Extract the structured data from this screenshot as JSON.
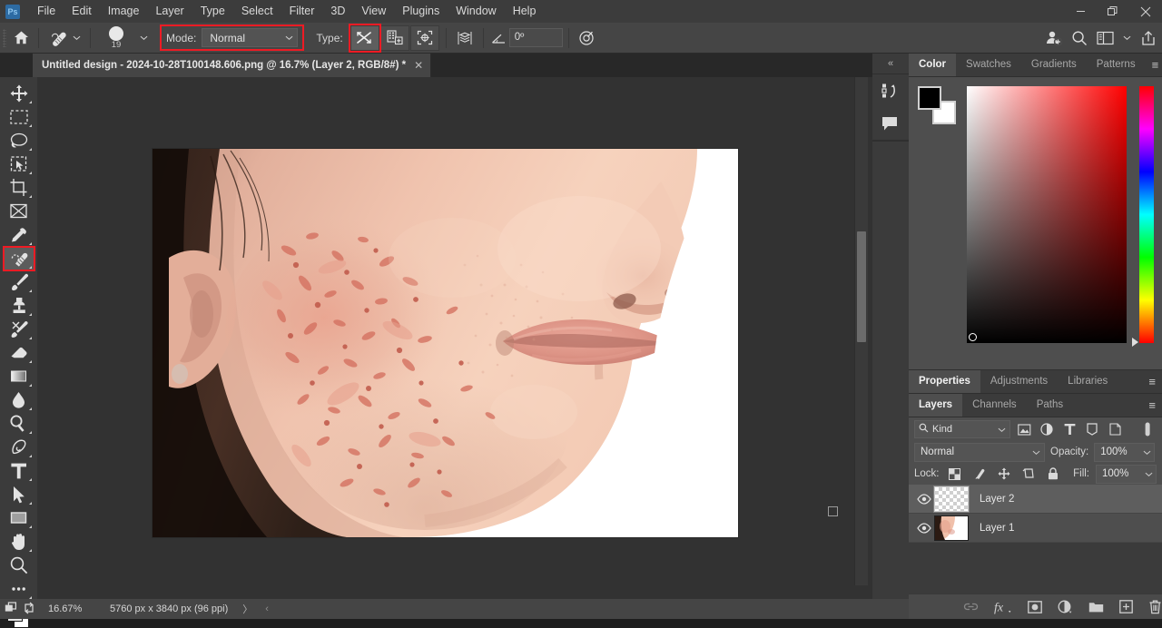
{
  "app": {
    "name": "Adobe Photoshop",
    "logo_text": "Ps"
  },
  "menubar": {
    "items": [
      {
        "label": "File"
      },
      {
        "label": "Edit"
      },
      {
        "label": "Image"
      },
      {
        "label": "Layer"
      },
      {
        "label": "Type"
      },
      {
        "label": "Select"
      },
      {
        "label": "Filter"
      },
      {
        "label": "3D"
      },
      {
        "label": "View"
      },
      {
        "label": "Plugins"
      },
      {
        "label": "Window"
      },
      {
        "label": "Help"
      }
    ],
    "window_controls": {
      "minimize": "—",
      "maximize": "❐",
      "close": "✕"
    }
  },
  "options_bar": {
    "home_icon": "home-icon",
    "tool_icon": "spot-healing-brush-icon",
    "brush_size": "19",
    "mode_label": "Mode:",
    "mode_value": "Normal",
    "mode_highlighted": true,
    "type_label": "Type:",
    "type_buttons": [
      {
        "name": "content-aware",
        "selected": true,
        "highlighted": true
      },
      {
        "name": "create-texture",
        "selected": false,
        "highlighted": false
      },
      {
        "name": "proximity-match",
        "selected": false,
        "highlighted": false
      }
    ],
    "sample_all_layers_icon": "stacked-layers-icon",
    "angle_label_icon": "angle-icon",
    "angle_value": "0º",
    "pressure_icon": "pressure-for-size-icon",
    "right_icons": [
      "share-person-icon",
      "search-icon",
      "workspace-icon",
      "chevron-down-icon",
      "export-icon"
    ]
  },
  "document": {
    "tab_title": "Untitled design - 2024-10-28T100148.606.png @ 16.7% (Layer 2, RGB/8#) *",
    "close_glyph": "✕"
  },
  "tools": [
    {
      "name": "move-tool",
      "icon": "move-icon",
      "has_flyout": true,
      "active": false,
      "highlighted": false
    },
    {
      "name": "rectangular-marquee-tool",
      "icon": "marquee-icon",
      "has_flyout": true,
      "active": false,
      "highlighted": false
    },
    {
      "name": "lasso-tool",
      "icon": "lasso-icon",
      "has_flyout": true,
      "active": false,
      "highlighted": false
    },
    {
      "name": "object-selection-tool",
      "icon": "object-selection-icon",
      "has_flyout": true,
      "active": false,
      "highlighted": false
    },
    {
      "name": "crop-tool",
      "icon": "crop-icon",
      "has_flyout": true,
      "active": false,
      "highlighted": false
    },
    {
      "name": "frame-tool",
      "icon": "frame-icon",
      "has_flyout": false,
      "active": false,
      "highlighted": false
    },
    {
      "name": "eyedropper-tool",
      "icon": "eyedropper-icon",
      "has_flyout": true,
      "active": false,
      "highlighted": false
    },
    {
      "name": "spot-healing-brush-tool",
      "icon": "spot-healing-brush-icon",
      "has_flyout": true,
      "active": true,
      "highlighted": true
    },
    {
      "name": "brush-tool",
      "icon": "brush-icon",
      "has_flyout": true,
      "active": false,
      "highlighted": false
    },
    {
      "name": "clone-stamp-tool",
      "icon": "clone-stamp-icon",
      "has_flyout": true,
      "active": false,
      "highlighted": false
    },
    {
      "name": "history-brush-tool",
      "icon": "history-brush-icon",
      "has_flyout": true,
      "active": false,
      "highlighted": false
    },
    {
      "name": "eraser-tool",
      "icon": "eraser-icon",
      "has_flyout": true,
      "active": false,
      "highlighted": false
    },
    {
      "name": "gradient-tool",
      "icon": "gradient-icon",
      "has_flyout": true,
      "active": false,
      "highlighted": false
    },
    {
      "name": "blur-tool",
      "icon": "blur-drop-icon",
      "has_flyout": true,
      "active": false,
      "highlighted": false
    },
    {
      "name": "dodge-tool",
      "icon": "dodge-icon",
      "has_flyout": true,
      "active": false,
      "highlighted": false
    },
    {
      "name": "pen-tool",
      "icon": "pen-icon",
      "has_flyout": true,
      "active": false,
      "highlighted": false
    },
    {
      "name": "type-tool",
      "icon": "type-t-icon",
      "has_flyout": true,
      "active": false,
      "highlighted": false
    },
    {
      "name": "path-selection-tool",
      "icon": "path-arrow-icon",
      "has_flyout": true,
      "active": false,
      "highlighted": false
    },
    {
      "name": "rectangle-tool",
      "icon": "rectangle-icon",
      "has_flyout": true,
      "active": false,
      "highlighted": false
    },
    {
      "name": "hand-tool",
      "icon": "hand-icon",
      "has_flyout": true,
      "active": false,
      "highlighted": false
    },
    {
      "name": "zoom-tool",
      "icon": "zoom-magnifier-icon",
      "has_flyout": false,
      "active": false,
      "highlighted": false
    },
    {
      "name": "edit-toolbar",
      "icon": "ellipsis-icon",
      "has_flyout": true,
      "active": false,
      "highlighted": false
    }
  ],
  "color_swatches": {
    "foreground": "#000000",
    "background": "#ffffff",
    "swap_icon": "swap-colors-icon"
  },
  "collapse_column": {
    "collapse_glyph": "«",
    "buttons": [
      {
        "name": "history-panel-icon"
      },
      {
        "name": "comments-panel-icon"
      }
    ]
  },
  "color_panel": {
    "tabs": [
      {
        "label": "Color",
        "active": true
      },
      {
        "label": "Swatches",
        "active": false
      },
      {
        "label": "Gradients",
        "active": false
      },
      {
        "label": "Patterns",
        "active": false
      }
    ],
    "menu_glyph": "≡",
    "foreground": "#000000",
    "background": "#ffffff",
    "field_base_color": "#ff0000"
  },
  "properties_panel": {
    "tabs": [
      {
        "label": "Properties",
        "active": true
      },
      {
        "label": "Adjustments",
        "active": false
      },
      {
        "label": "Libraries",
        "active": false
      }
    ],
    "menu_glyph": "≡"
  },
  "layers_panel": {
    "tabs": [
      {
        "label": "Layers",
        "active": true
      },
      {
        "label": "Channels",
        "active": false
      },
      {
        "label": "Paths",
        "active": false
      }
    ],
    "menu_glyph": "≡",
    "filter": {
      "search_icon": "search-icon",
      "kind_label": "Kind",
      "chevron": "⌄",
      "filter_icons": [
        "image-filter-icon",
        "adjustment-filter-icon",
        "type-filter-icon",
        "shape-filter-icon",
        "smart-object-filter-icon"
      ],
      "toggle_icon": "filter-toggle-icon"
    },
    "blend_mode": "Normal",
    "opacity_label": "Opacity:",
    "opacity_value": "100%",
    "lock_label": "Lock:",
    "lock_icons": [
      "lock-transparent-pixels-icon",
      "lock-image-pixels-icon",
      "lock-position-icon",
      "lock-artboard-nesting-icon",
      "lock-all-icon"
    ],
    "fill_label": "Fill:",
    "fill_value": "100%",
    "layers": [
      {
        "name": "Layer 2",
        "visible": true,
        "selected": true,
        "thumb": "transparent"
      },
      {
        "name": "Layer 1",
        "visible": true,
        "selected": false,
        "thumb": "photo"
      }
    ],
    "footer_icons": [
      {
        "name": "link-layers-icon",
        "glyph": "⊕",
        "disabled": true
      },
      {
        "name": "layer-style-fx-icon",
        "glyph": "fx",
        "disabled": false
      },
      {
        "name": "add-layer-mask-icon",
        "glyph": "▣",
        "disabled": false
      },
      {
        "name": "new-adjustment-layer-icon",
        "glyph": "◑",
        "disabled": false
      },
      {
        "name": "new-group-icon",
        "glyph": "▬",
        "disabled": false
      },
      {
        "name": "new-layer-icon",
        "glyph": "⊞",
        "disabled": false
      },
      {
        "name": "delete-layer-icon",
        "glyph": "Ὕ1",
        "disabled": false
      }
    ]
  },
  "status_bar": {
    "zoom": "16.67%",
    "doc_size": "5760 px x 3840 px (96 ppi)",
    "arrow_right": "〉",
    "arrow_left": "‹"
  },
  "canvas": {
    "image_description": "Close-up photo of a young woman's cheek and lower face with acne on a white background",
    "cursor_marker": "brush-cursor-square"
  },
  "colors": {
    "accent_red": "#ee1b24",
    "panel_bg": "#4e4e4e",
    "app_bg": "#323232",
    "toolbar_bg": "#3b3b3b",
    "menubar_bg": "#3c3c3c"
  }
}
